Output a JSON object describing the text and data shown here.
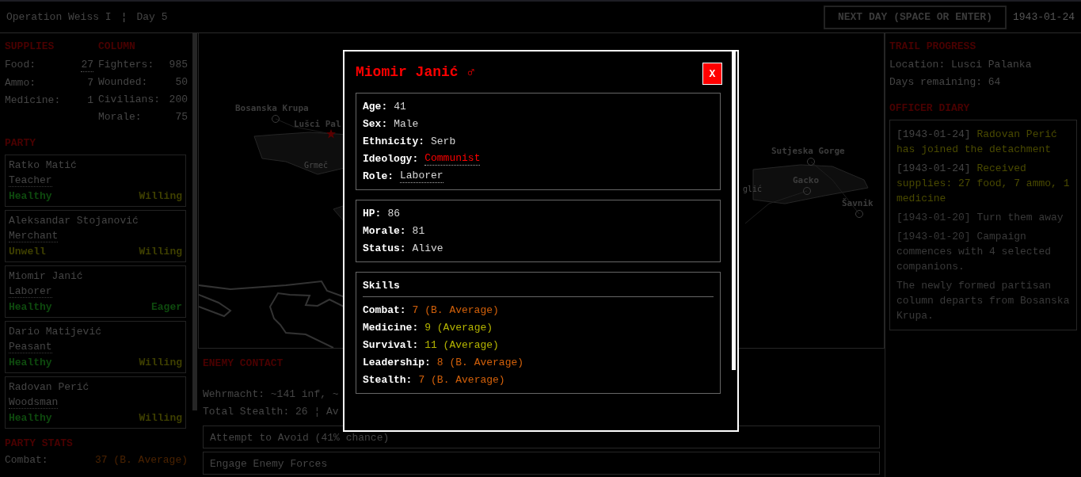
{
  "header": {
    "title": "Operation Weiss I",
    "separator": "¦",
    "day": "Day 5",
    "next_day_button": "NEXT DAY (SPACE OR ENTER)",
    "date": "1943-01-24"
  },
  "supplies": {
    "heading": "SUPPLIES",
    "items": [
      {
        "label": "Food:",
        "value": "27",
        "underlined": true
      },
      {
        "label": "Ammo:",
        "value": "7",
        "underlined": false
      },
      {
        "label": "Medicine:",
        "value": "1",
        "underlined": false
      }
    ]
  },
  "column": {
    "heading": "COLUMN",
    "items": [
      {
        "label": "Fighters:",
        "value": "985"
      },
      {
        "label": "Wounded:",
        "value": "50"
      },
      {
        "label": "Civilians:",
        "value": "200"
      },
      {
        "label": "Morale:",
        "value": "75"
      }
    ]
  },
  "party": {
    "heading": "PARTY",
    "members": [
      {
        "name": "Ratko Matić",
        "role": "Teacher",
        "health": {
          "text": "Healthy",
          "color": "#0e4a0e"
        },
        "attitude": {
          "text": "Willing",
          "color": "#3f4000"
        }
      },
      {
        "name": "Aleksandar Stojanović",
        "role": "Merchant",
        "health": {
          "text": "Unwell",
          "color": "#3f4000"
        },
        "attitude": {
          "text": "Willing",
          "color": "#3f4000"
        }
      },
      {
        "name": "Miomir Janić",
        "role": "Laborer",
        "health": {
          "text": "Healthy",
          "color": "#0e4a0e"
        },
        "attitude": {
          "text": "Eager",
          "color": "#0e4a0e"
        }
      },
      {
        "name": "Dario Matijević",
        "role": "Peasant",
        "health": {
          "text": "Healthy",
          "color": "#0e4a0e"
        },
        "attitude": {
          "text": "Willing",
          "color": "#3f4000"
        }
      },
      {
        "name": "Radovan Perić",
        "role": "Woodsman",
        "health": {
          "text": "Healthy",
          "color": "#0e4a0e"
        },
        "attitude": {
          "text": "Willing",
          "color": "#3f4000"
        }
      }
    ]
  },
  "party_stats": {
    "heading": "PARTY STATS",
    "items": [
      {
        "label": "Combat:",
        "value": "37 (B. Average)",
        "color": "#4a2200"
      }
    ]
  },
  "map": {
    "locations": [
      {
        "name": "Bosanska Krupa",
        "current": false
      },
      {
        "name": "Lušci Pal",
        "current": true
      },
      {
        "name": "Sutjeska Gorge",
        "current": false
      },
      {
        "name": "Gacko",
        "current": false
      },
      {
        "name": "Šavnik",
        "current": false
      }
    ],
    "regions": [
      "Grmeč",
      "glić"
    ]
  },
  "enemy_contact": {
    "heading": "ENEMY CONTACT",
    "lines": [
      "Wehrmacht: ~141 inf, ~",
      "Total Stealth: 26 ¦ Av"
    ],
    "actions": [
      "Attempt to Avoid (41% chance)",
      "Engage Enemy Forces"
    ]
  },
  "trail_progress": {
    "heading": "TRAIL PROGRESS",
    "lines": [
      "Location: Lusci Palanka",
      "Days remaining: 64"
    ]
  },
  "officer_diary": {
    "heading": "OFFICER DIARY",
    "entries": [
      {
        "date": "[1943-01-24]",
        "text": "Radovan Perić has joined the detachment",
        "faded": false
      },
      {
        "date": "[1943-01-24]",
        "text": "Received supplies: 27 food, 7 ammo, 1 medicine",
        "faded": false
      },
      {
        "date": "[1943-01-20]",
        "text": "Turn them away",
        "faded": true
      },
      {
        "date": "[1943-01-20]",
        "text": "Campaign commences with 4 selected companions.",
        "faded": true
      },
      {
        "text": "The newly formed partisan column departs from Bosanska Krupa.",
        "faded": true
      }
    ]
  },
  "modal": {
    "title": "Miomir Janić",
    "sex_symbol": "♂",
    "close": "X",
    "info": [
      {
        "label": "Age:",
        "value": "41",
        "underlined": false
      },
      {
        "label": "Sex:",
        "value": "Male",
        "underlined": false
      },
      {
        "label": "Ethnicity:",
        "value": "Serb",
        "underlined": false
      },
      {
        "label": "Ideology:",
        "value": "Communist",
        "underlined": true,
        "color": "#ff0000"
      },
      {
        "label": "Role:",
        "value": "Laborer",
        "underlined": true
      }
    ],
    "vitals": [
      {
        "label": "HP:",
        "value": "86"
      },
      {
        "label": "Morale:",
        "value": "81"
      },
      {
        "label": "Status:",
        "value": "Alive"
      }
    ],
    "skills_heading": "Skills",
    "skills": [
      {
        "label": "Combat:",
        "value": "7 (B. Average)",
        "color": "#d2600a"
      },
      {
        "label": "Medicine:",
        "value": "9 (Average)",
        "color": "#b4b400"
      },
      {
        "label": "Survival:",
        "value": "11 (Average)",
        "color": "#b4b400"
      },
      {
        "label": "Leadership:",
        "value": "8 (B. Average)",
        "color": "#d2600a"
      },
      {
        "label": "Stealth:",
        "value": "7 (B. Average)",
        "color": "#d2600a"
      }
    ]
  }
}
